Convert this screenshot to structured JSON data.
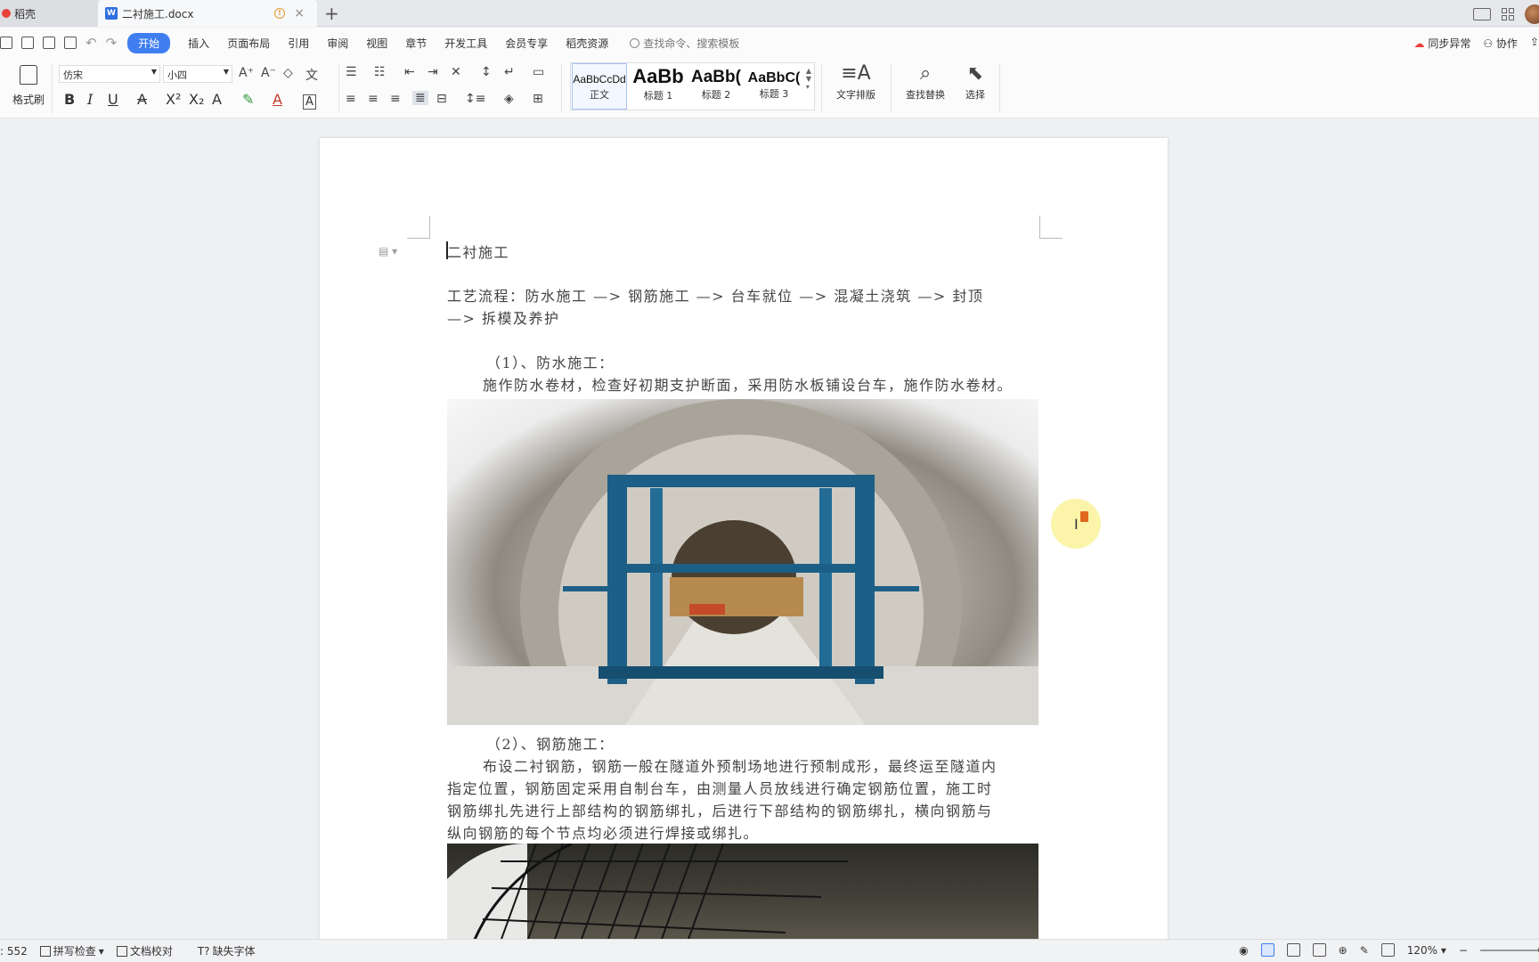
{
  "tabs": {
    "home_label": "稻壳",
    "doc_label": "二衬施工.docx",
    "new_tab": "+"
  },
  "menu": {
    "items": [
      "开始",
      "插入",
      "页面布局",
      "引用",
      "审阅",
      "视图",
      "章节",
      "开发工具",
      "会员专享",
      "稻壳资源"
    ],
    "search_placeholder": "查找命令、搜索模板",
    "sync_label": "同步异常",
    "collab_label": "协作"
  },
  "ribbon": {
    "format_painter": "格式刷",
    "font_name": "仿宋",
    "font_size": "小四",
    "styles": [
      {
        "sample": "AaBbCcDd",
        "label": "正文"
      },
      {
        "sample": "AaBb",
        "label": "标题 1"
      },
      {
        "sample": "AaBb(",
        "label": "标题 2"
      },
      {
        "sample": "AaBbC(",
        "label": "标题 3"
      }
    ],
    "text_layout": "文字排版",
    "find_replace": "查找替换",
    "select": "选择"
  },
  "document": {
    "title": "二衬施工",
    "flow_line1": "工艺流程：防水施工 —> 钢筋施工 —> 台车就位 —> 混凝土浇筑 —> 封顶",
    "flow_line2": "—> 拆模及养护",
    "section1_heading": "（1）、防水施工：",
    "section1_body": "施作防水卷材，检查好初期支护断面，采用防水板铺设台车，施作防水卷材。",
    "section2_heading": "（2）、钢筋施工：",
    "section2_body_lines": [
      "布设二衬钢筋，钢筋一般在隧道外预制场地进行预制成形，最终运至隧道内",
      "指定位置，钢筋固定采用自制台车，由测量人员放线进行确定钢筋位置，施工时",
      "钢筋绑扎先进行上部结构的钢筋绑扎，后进行下部结构的钢筋绑扎，横向钢筋与",
      "纵向钢筋的每个节点均必须进行焊接或绑扎。"
    ]
  },
  "status": {
    "word_count": ": 552",
    "spell_check": "拼写检查",
    "doc_proof": "文档校对",
    "missing_font": "缺失字体",
    "zoom": "120%"
  }
}
